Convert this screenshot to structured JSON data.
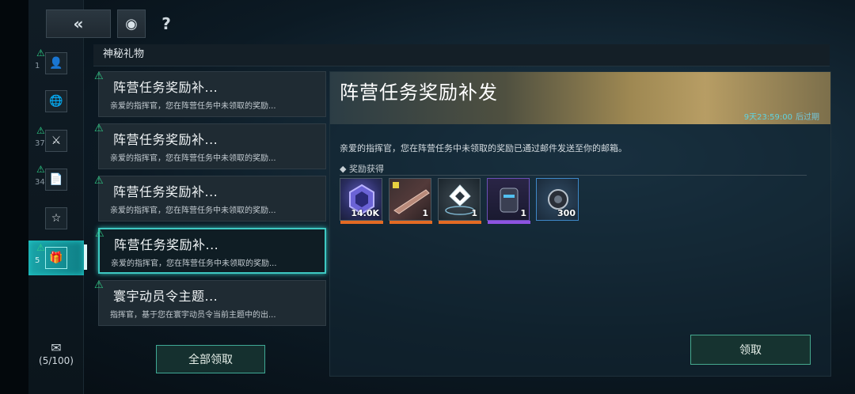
{
  "toolbar": {
    "back_icon": "double-chevron-left-icon",
    "back_symbol": "«",
    "record_symbol": "◉",
    "help_symbol": "?"
  },
  "nav": {
    "items": [
      {
        "icon": "user-icon",
        "symbol": "👤",
        "count": "1",
        "alert": true
      },
      {
        "icon": "globe-icon",
        "symbol": "🌐",
        "count": "",
        "alert": false
      },
      {
        "icon": "crossed-swords-icon",
        "symbol": "⚔",
        "count": "37",
        "alert": true
      },
      {
        "icon": "document-icon",
        "symbol": "📄",
        "count": "34",
        "alert": true
      },
      {
        "icon": "star-icon",
        "symbol": "☆",
        "count": "",
        "alert": false
      },
      {
        "icon": "gift-icon",
        "symbol": "🎁",
        "count": "5",
        "alert": true
      }
    ],
    "mail_symbol": "✉",
    "mail_count": "(5/100)"
  },
  "section_title": "神秘礼物",
  "list": {
    "items": [
      {
        "title": "阵营任务奖励补...",
        "desc": "亲爱的指挥官，您在阵营任务中未领取的奖励..."
      },
      {
        "title": "阵营任务奖励补...",
        "desc": "亲爱的指挥官，您在阵营任务中未领取的奖励..."
      },
      {
        "title": "阵营任务奖励补...",
        "desc": "亲爱的指挥官，您在阵营任务中未领取的奖励..."
      },
      {
        "title": "阵营任务奖励补...",
        "desc": "亲爱的指挥官，您在阵营任务中未领取的奖励..."
      },
      {
        "title": "寰宇动员令主题...",
        "desc": "指挥官，基于您在寰宇动员令当前主题中的出..."
      }
    ],
    "selected_index": 3,
    "claim_all_label": "全部领取"
  },
  "detail": {
    "title": "阵营任务奖励补发",
    "expiry_time": "9天23:59:00",
    "expiry_label": "后过期",
    "message": "亲爱的指挥官，您在阵营任务中未领取的奖励已通过邮件发送至你的邮箱。",
    "reward_header": "◆  奖励获得",
    "rewards": [
      {
        "icon": "hexagon-token-icon",
        "qty": "14.0K",
        "rarity_color": "#e36a23"
      },
      {
        "icon": "ship-blueprint-icon",
        "qty": "1",
        "rarity_color": "#e36a23"
      },
      {
        "icon": "diamond-beacon-icon",
        "qty": "1",
        "rarity_color": "#e36a23"
      },
      {
        "icon": "canister-icon",
        "qty": "1",
        "rarity_color": "#8d53e1"
      },
      {
        "icon": "engine-part-icon",
        "qty": "300",
        "rarity_color": "#3f88c8"
      }
    ],
    "claim_label": "领取"
  }
}
